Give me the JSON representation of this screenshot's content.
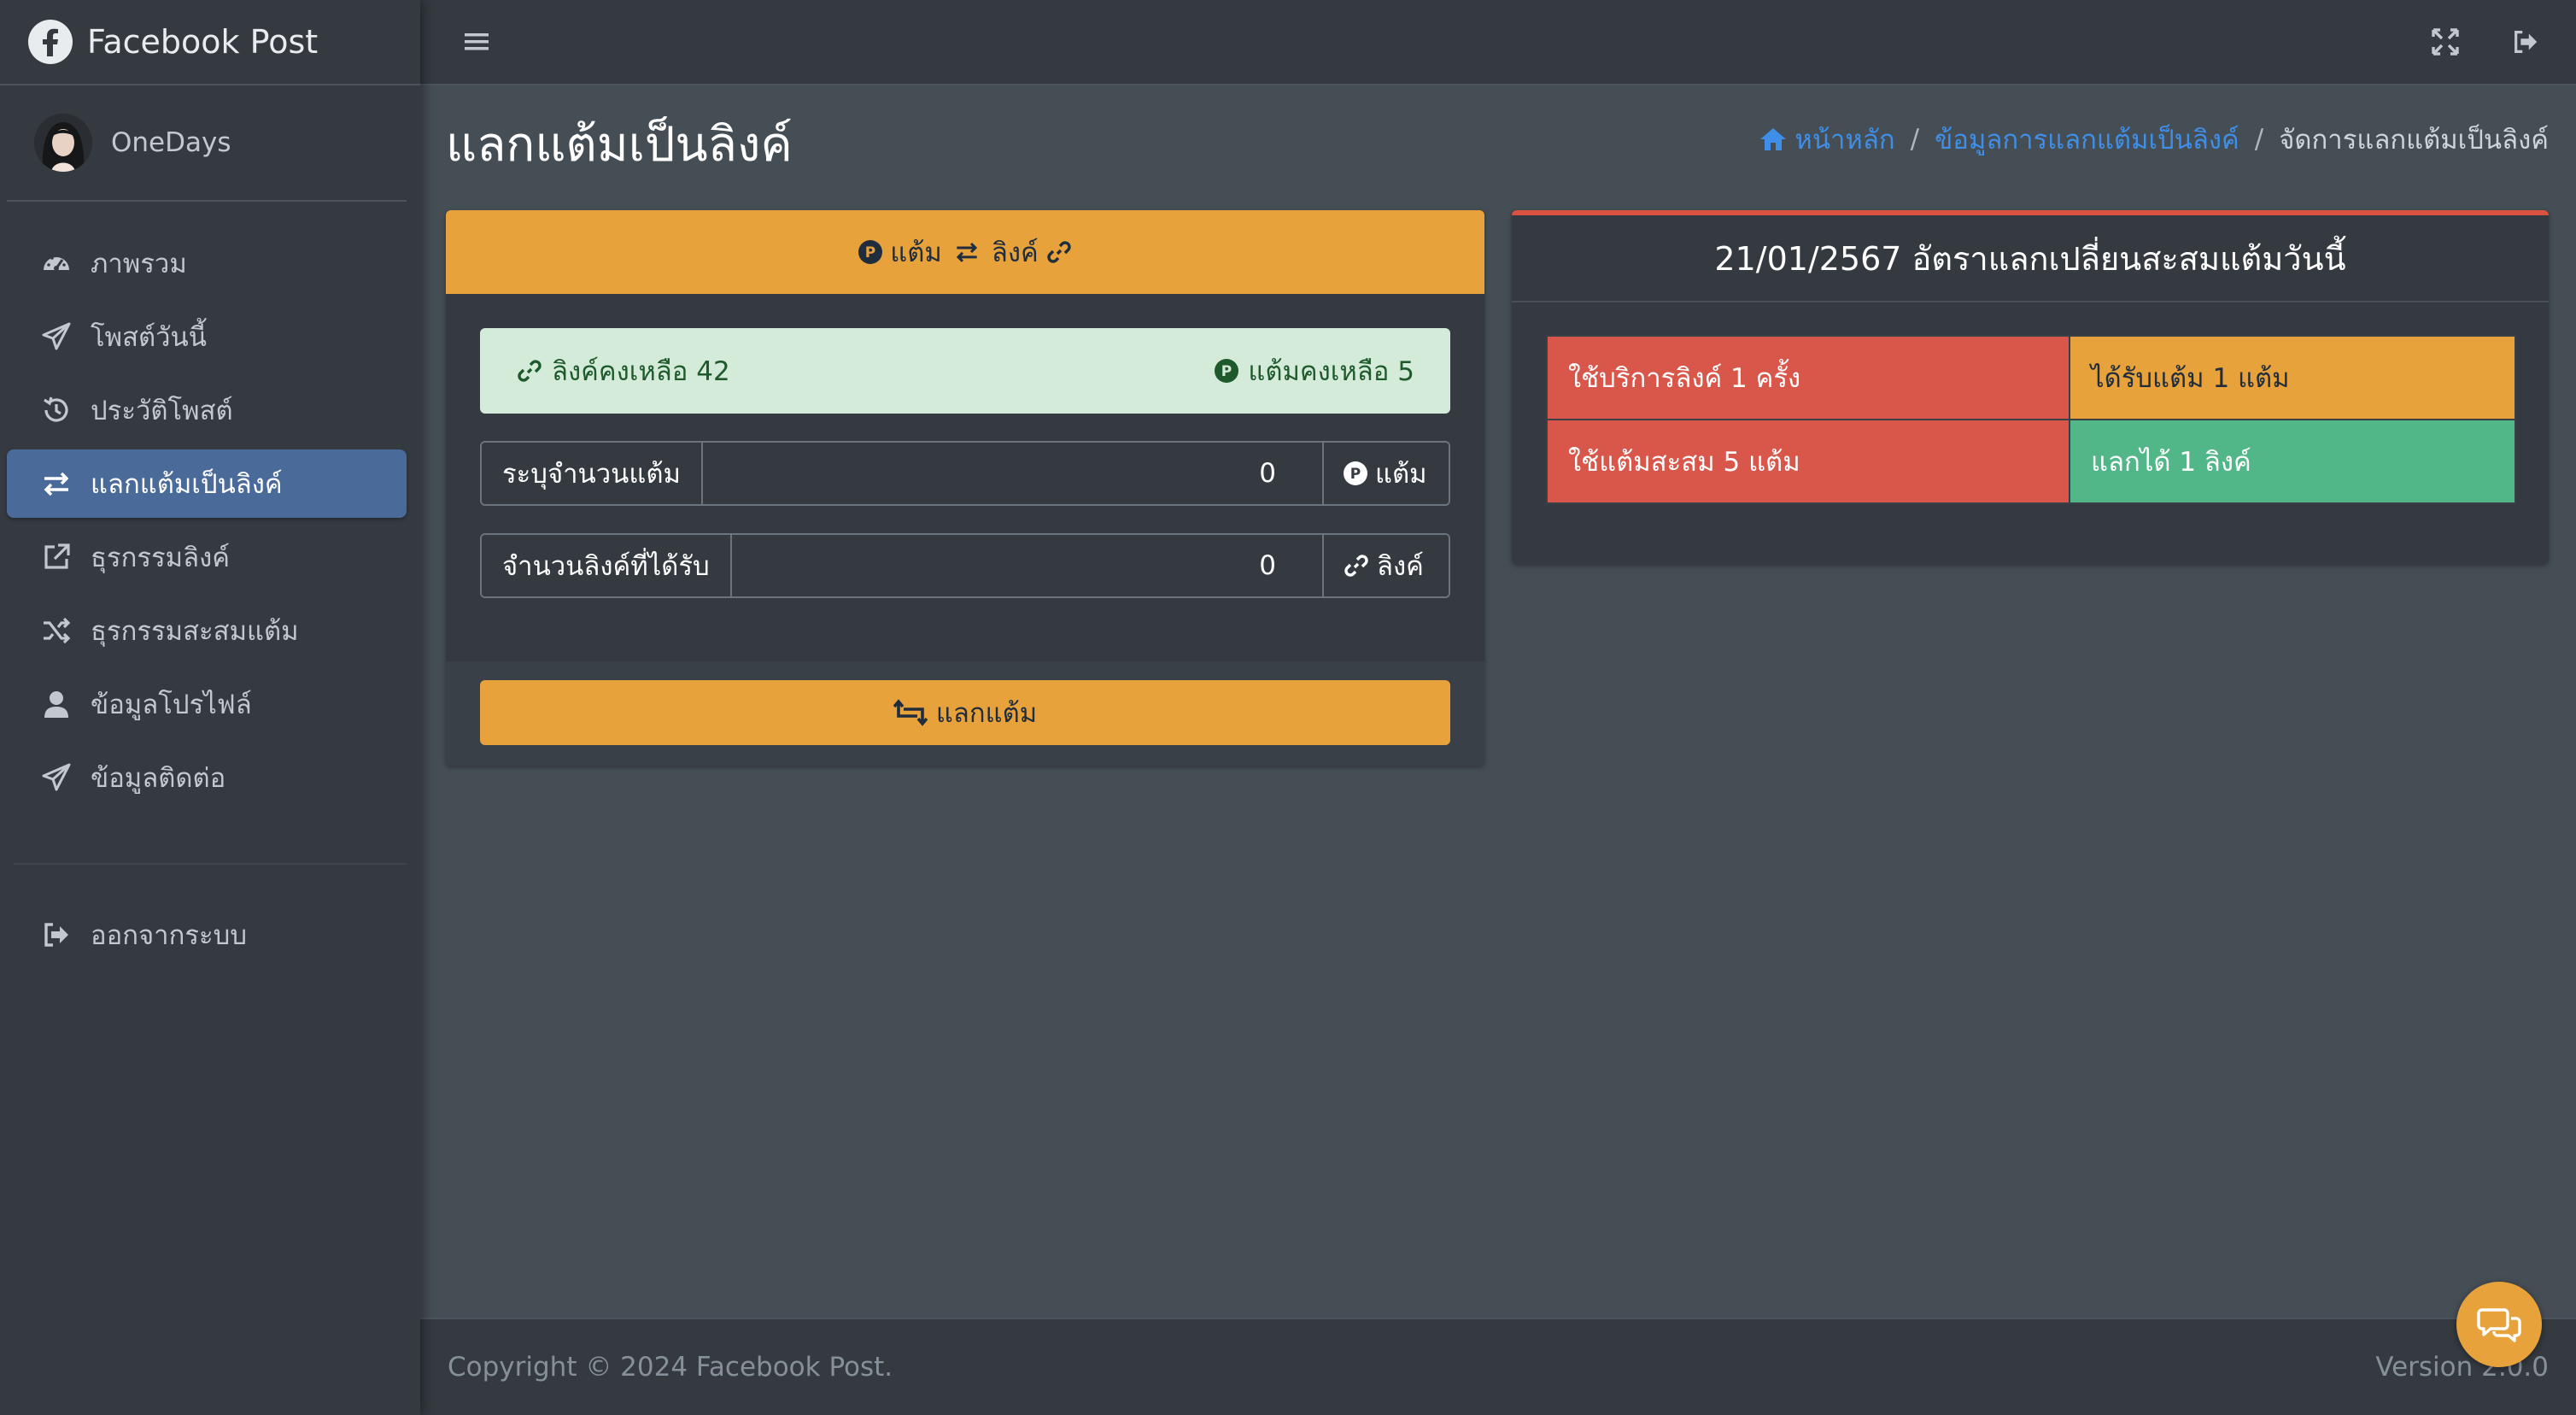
{
  "brand": {
    "name": "Facebook Post",
    "logo_icon": "facebook-icon"
  },
  "user": {
    "name": "OneDays"
  },
  "sidebar": {
    "items": [
      {
        "label": "ภาพรวม",
        "icon": "speedometer-icon"
      },
      {
        "label": "โพสต์วันนี้",
        "icon": "paper-plane-icon"
      },
      {
        "label": "ประวัติโพสต์",
        "icon": "history-icon"
      },
      {
        "label": "แลกแต้มเป็นลิงค์",
        "icon": "exchange-arrows-icon",
        "active": true
      },
      {
        "label": "ธุรกรรมลิงค์",
        "icon": "external-link-icon"
      },
      {
        "label": "ธุรกรรมสะสมแต้ม",
        "icon": "shuffle-icon"
      },
      {
        "label": "ข้อมูลโปรไฟล์",
        "icon": "user-icon"
      },
      {
        "label": "ข้อมูลติดต่อ",
        "icon": "paper-plane-icon"
      }
    ],
    "logout": {
      "label": "ออกจากระบบ",
      "icon": "sign-out-icon"
    }
  },
  "page": {
    "title": "แลกแต้มเป็นลิงค์"
  },
  "breadcrumb": {
    "home": "หน้าหลัก",
    "parent": "ข้อมูลการแลกแต้มเป็นลิงค์",
    "current": "จัดการแลกแต้มเป็นลิงค์"
  },
  "exchange_card": {
    "header": {
      "points_label": "แต้ม",
      "link_label": "ลิงค์"
    },
    "alert": {
      "links_left": "ลิงค์คงเหลือ 42",
      "points_left": "แต้มคงเหลือ 5"
    },
    "points_input": {
      "label": "ระบุจำนวนแต้ม",
      "value": "0",
      "suffix": "แต้ม"
    },
    "links_input": {
      "label": "จำนวนลิงค์ที่ได้รับ",
      "value": "0",
      "suffix": "ลิงค์"
    },
    "button": "แลกแต้ม"
  },
  "rate_card": {
    "title": "21/01/2567 อัตราแลกเปลี่ยนสะสมแต้มวันนี้",
    "rows": [
      {
        "left": "ใช้บริการลิงค์ 1 ครั้ง",
        "right": "ได้รับแต้ม 1 แต้ม"
      },
      {
        "left": "ใช้แต้มสะสม 5 แต้ม",
        "right": "แลกได้ 1 ลิงค์"
      }
    ]
  },
  "footer": {
    "copyright": "Copyright © 2024 Facebook Post.",
    "version": "Version 2.0.0"
  },
  "colors": {
    "accent": "#e8a23b",
    "active_nav": "#4a6a9a",
    "danger": "#d9574a",
    "success": "#52b788",
    "link": "#3f8fe8"
  }
}
